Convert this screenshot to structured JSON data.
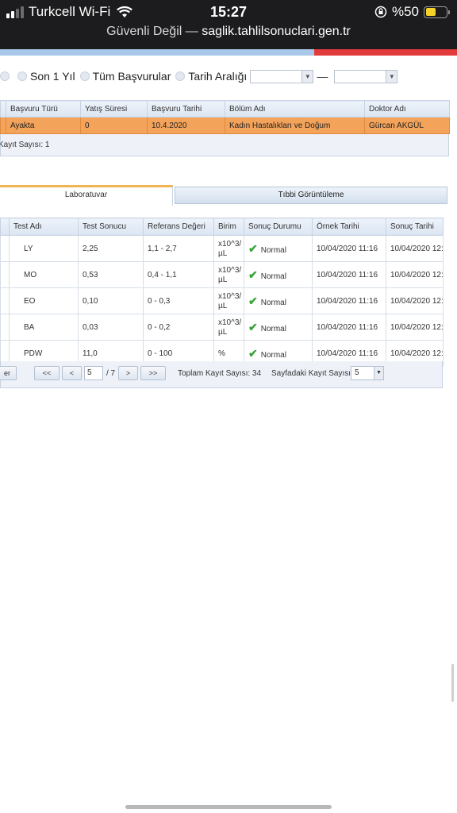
{
  "status_bar": {
    "carrier": "Turkcell Wi-Fi",
    "time": "15:27",
    "battery": "%50"
  },
  "url_bar": {
    "security": "Güvenli Değil —",
    "domain": "saglik.tahlilsonuclari.gen.tr"
  },
  "filters": {
    "options": [
      "Son 1 Yıl",
      "Tüm Başvurular",
      "Tarih Aralığı"
    ],
    "date_separator": "—"
  },
  "applications": {
    "headers": [
      "Başvuru Türü",
      "Yatış Süresi",
      "Başvuru Tarihi",
      "Bölüm Adı",
      "Doktor Adı"
    ],
    "rows": [
      {
        "type": "Ayakta",
        "stay": "0",
        "date": "10.4.2020",
        "department": "Kadın Hastalıkları ve Doğum",
        "doctor": "Gürcan AKGÜL"
      }
    ],
    "record_count": "Kayıt Sayısı: 1"
  },
  "tabs": {
    "lab": "Laboratuvar",
    "imaging": "Tıbbi Görüntüleme"
  },
  "results": {
    "headers": [
      "Test Adı",
      "Test Sonucu",
      "Referans Değeri",
      "Birim",
      "Sonuç Durumu",
      "Örnek Tarihi",
      "Sonuç Tarihi"
    ],
    "rows": [
      {
        "name": "LY",
        "value": "2,25",
        "ref": "1,1 - 2,7",
        "unit": "x10^3/ µL",
        "status": "Normal",
        "sample_date": "10/04/2020 11:16",
        "result_date": "10/04/2020 12:"
      },
      {
        "name": "MO",
        "value": "0,53",
        "ref": "0,4 - 1,1",
        "unit": "x10^3/ µL",
        "status": "Normal",
        "sample_date": "10/04/2020 11:16",
        "result_date": "10/04/2020 12:"
      },
      {
        "name": "EO",
        "value": "0,10",
        "ref": "0 - 0,3",
        "unit": "x10^3/ µL",
        "status": "Normal",
        "sample_date": "10/04/2020 11:16",
        "result_date": "10/04/2020 12:"
      },
      {
        "name": "BA",
        "value": "0,03",
        "ref": "0 - 0,2",
        "unit": "x10^3/ µL",
        "status": "Normal",
        "sample_date": "10/04/2020 11:16",
        "result_date": "10/04/2020 12:"
      },
      {
        "name": "PDW",
        "value": "11,0",
        "ref": "0 - 100",
        "unit": "%",
        "status": "Normal",
        "sample_date": "10/04/2020 11:16",
        "result_date": "10/04/2020 12:"
      }
    ]
  },
  "pager": {
    "left_button": "er",
    "first": "<<",
    "prev": "<",
    "current_page": "5",
    "total_pages": "/ 7",
    "next": ">",
    "last": ">>",
    "total_records": "Toplam Kayıt Sayısı: 34",
    "per_page_label": "Sayfadaki Kayıt Sayısı",
    "per_page_value": "5"
  }
}
